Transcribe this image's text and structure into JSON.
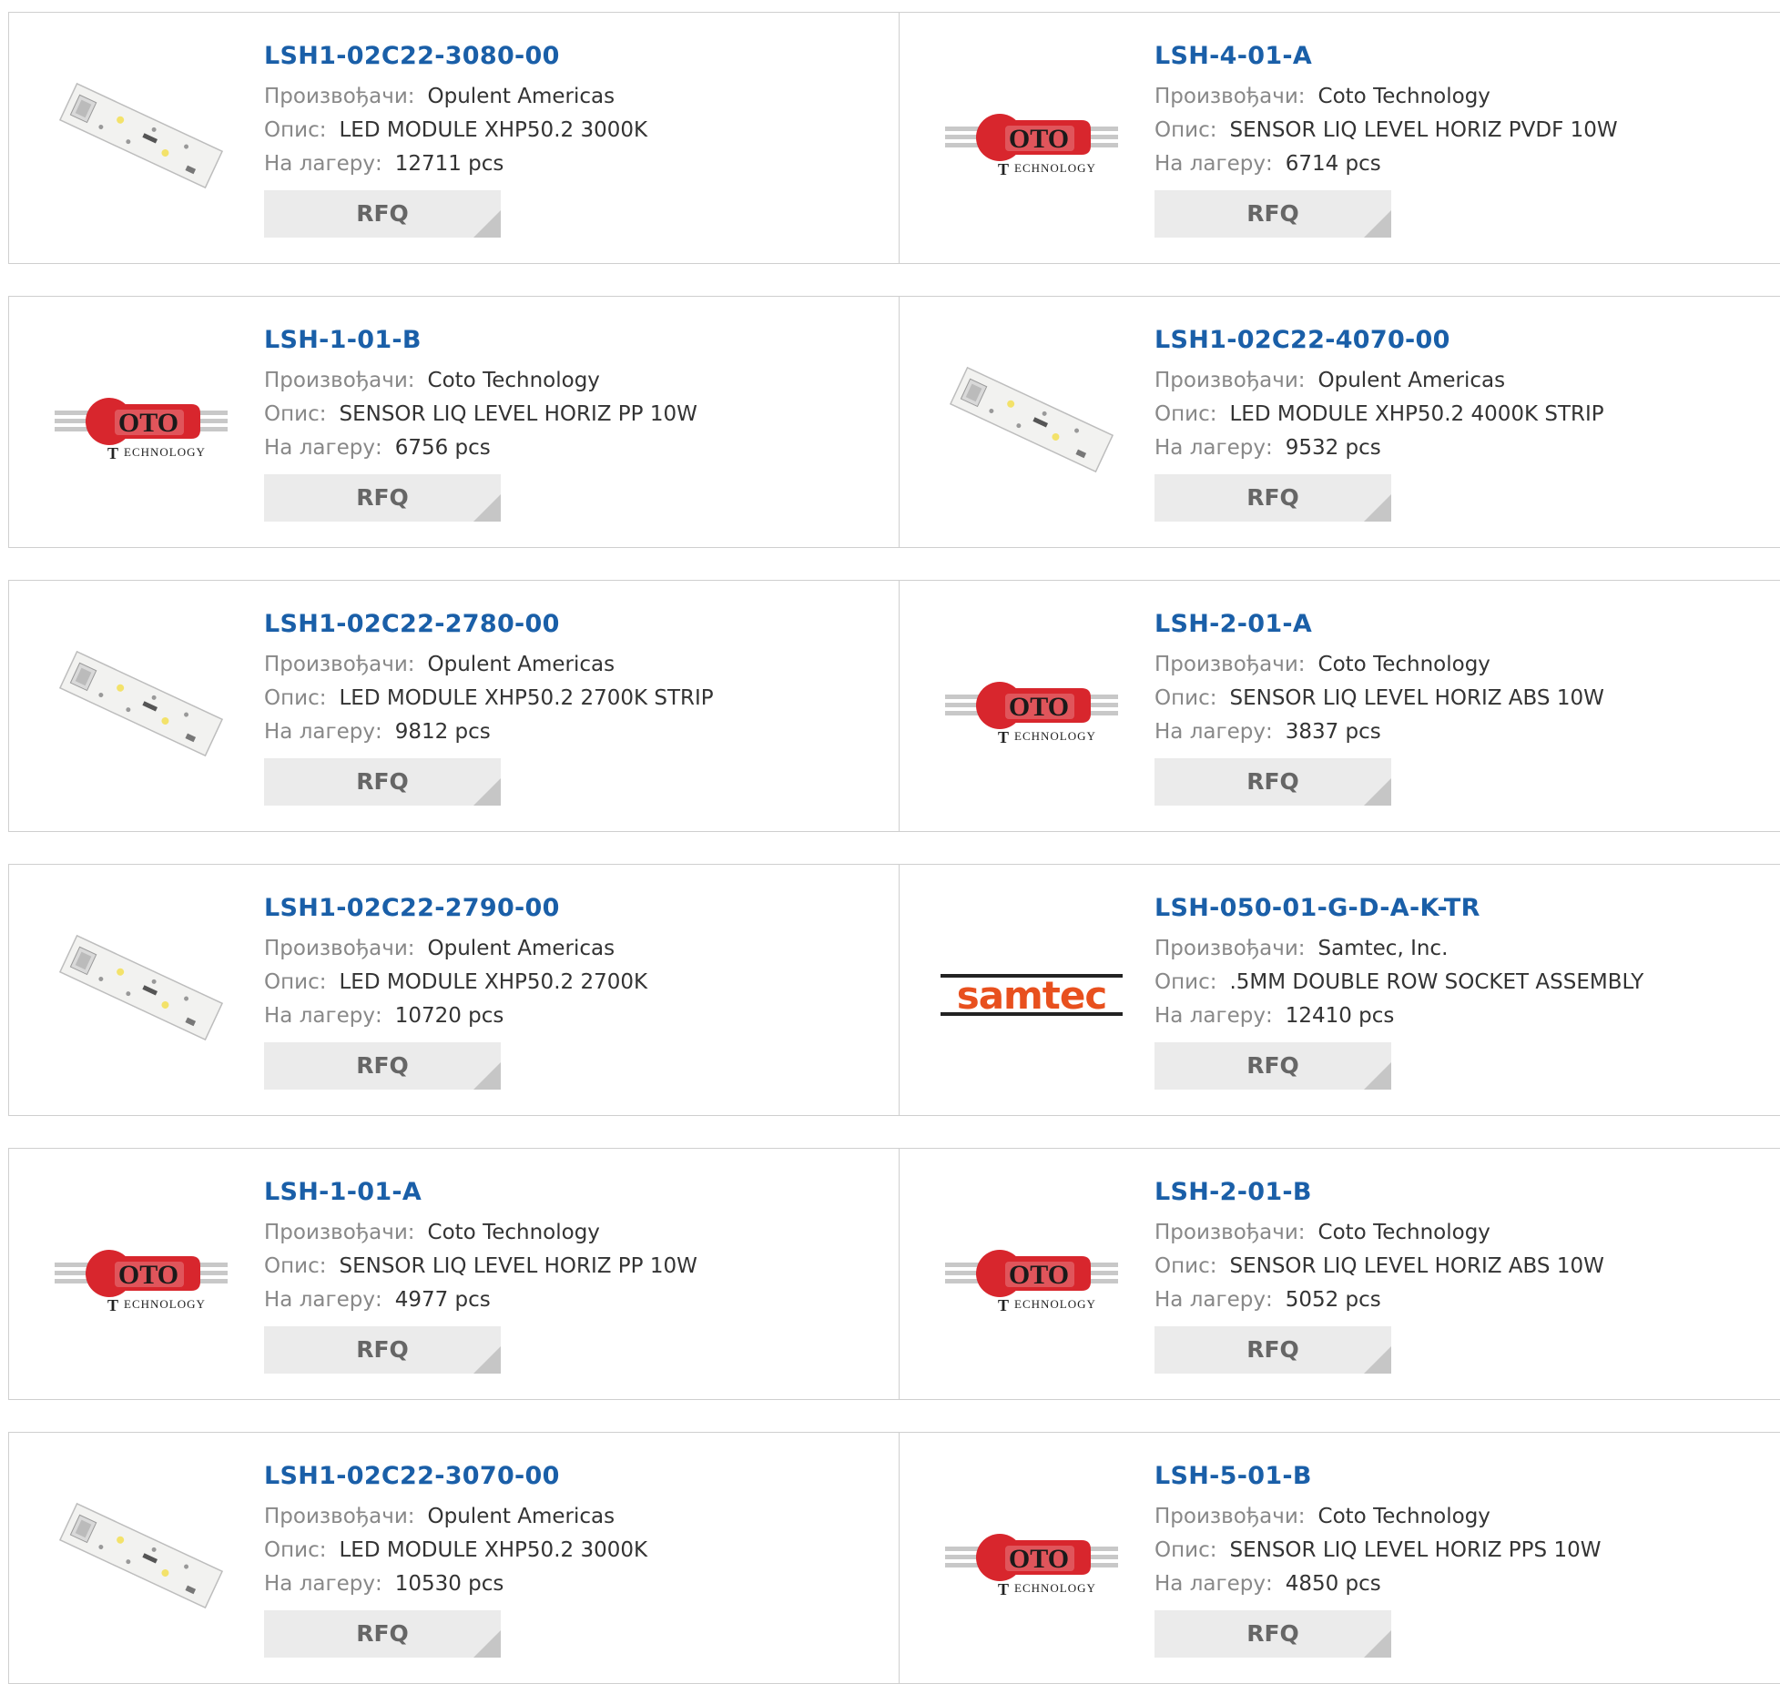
{
  "labels": {
    "manufacturer": "Произвођачи:",
    "description": "Опис:",
    "stock": "На лагеру:",
    "rfq": "RFQ"
  },
  "brand_colors": {
    "link": "#1a5fa8",
    "coto_red": "#d8262d",
    "samtec_orange": "#e8501e"
  },
  "products": [
    {
      "part": "LSH1-02C22-3080-00",
      "manufacturer": "Opulent Americas",
      "description": "LED MODULE XHP50.2 3000K",
      "stock": "12711 pcs",
      "image": "led-module-image"
    },
    {
      "part": "LSH-4-01-A",
      "manufacturer": "Coto Technology",
      "description": "SENSOR LIQ LEVEL HORIZ PVDF 10W",
      "stock": "6714 pcs",
      "image": "coto-technology-logo"
    },
    {
      "part": "LSH-1-01-B",
      "manufacturer": "Coto Technology",
      "description": "SENSOR LIQ LEVEL HORIZ PP 10W",
      "stock": "6756 pcs",
      "image": "coto-technology-logo"
    },
    {
      "part": "LSH1-02C22-4070-00",
      "manufacturer": "Opulent Americas",
      "description": "LED MODULE XHP50.2 4000K STRIP",
      "stock": "9532 pcs",
      "image": "led-module-image"
    },
    {
      "part": "LSH1-02C22-2780-00",
      "manufacturer": "Opulent Americas",
      "description": "LED MODULE XHP50.2 2700K STRIP",
      "stock": "9812 pcs",
      "image": "led-module-image"
    },
    {
      "part": "LSH-2-01-A",
      "manufacturer": "Coto Technology",
      "description": "SENSOR LIQ LEVEL HORIZ ABS 10W",
      "stock": "3837 pcs",
      "image": "coto-technology-logo"
    },
    {
      "part": "LSH1-02C22-2790-00",
      "manufacturer": "Opulent Americas",
      "description": "LED MODULE XHP50.2 2700K",
      "stock": "10720 pcs",
      "image": "led-module-image"
    },
    {
      "part": "LSH-050-01-G-D-A-K-TR",
      "manufacturer": "Samtec, Inc.",
      "description": ".5MM DOUBLE ROW SOCKET ASSEMBLY",
      "stock": "12410 pcs",
      "image": "samtec-logo"
    },
    {
      "part": "LSH-1-01-A",
      "manufacturer": "Coto Technology",
      "description": "SENSOR LIQ LEVEL HORIZ PP 10W",
      "stock": "4977 pcs",
      "image": "coto-technology-logo"
    },
    {
      "part": "LSH-2-01-B",
      "manufacturer": "Coto Technology",
      "description": "SENSOR LIQ LEVEL HORIZ ABS 10W",
      "stock": "5052 pcs",
      "image": "coto-technology-logo"
    },
    {
      "part": "LSH1-02C22-3070-00",
      "manufacturer": "Opulent Americas",
      "description": "LED MODULE XHP50.2 3000K",
      "stock": "10530 pcs",
      "image": "led-module-image"
    },
    {
      "part": "LSH-5-01-B",
      "manufacturer": "Coto Technology",
      "description": "SENSOR LIQ LEVEL HORIZ PPS 10W",
      "stock": "4850 pcs",
      "image": "coto-technology-logo"
    }
  ]
}
